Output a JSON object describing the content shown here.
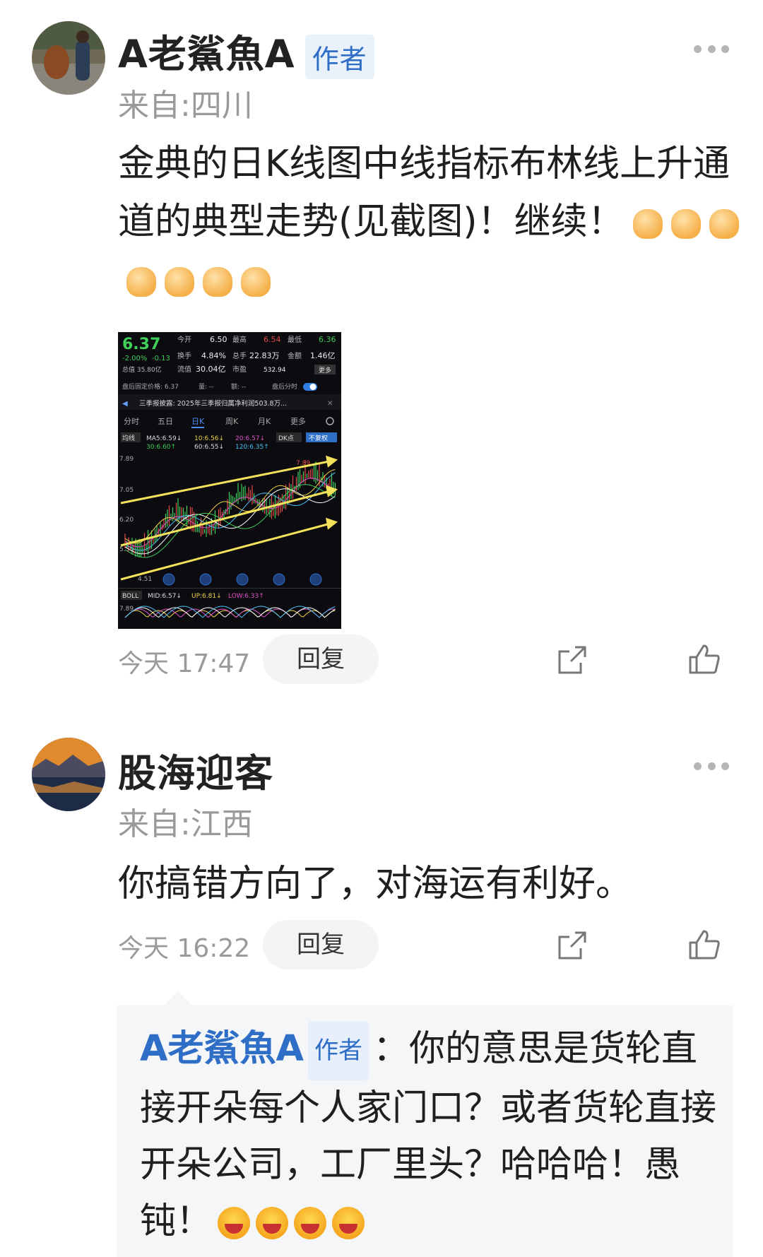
{
  "comments": [
    {
      "user": "A老鯊魚A",
      "tag": "作者",
      "location": "来自:四川",
      "text": "金典的日K线图中线指标布林线上升通道的典型走势(见截图)！继续！",
      "emoji_count": 7,
      "time": "今天 17:47",
      "reply_label": "回复",
      "attachment": {
        "price": "6.37",
        "open_label": "今开",
        "open": "6.50",
        "high_label": "最高",
        "high": "6.54",
        "low_label": "最低",
        "low": "6.36",
        "change": "-2.00%",
        "change_abs": "-0.13",
        "turnover_label": "换手",
        "turnover": "4.84%",
        "volume_label": "总手",
        "volume": "22.83万",
        "amount_label": "金额",
        "amount": "1.46亿",
        "mcap": "总值 35.80亿",
        "float_label": "流值",
        "float": "30.04亿",
        "pe_label": "市盈",
        "pe": "532.94",
        "more_label": "更多",
        "after_hours": "盘后固定价格: 6.37",
        "after_vol": "量: --",
        "after_amt": "额: --",
        "after_toggle": "盘后分时",
        "news": "三季报披露: 2025年三季报归属净利润503.8万...",
        "tabs": [
          "分时",
          "五日",
          "日K",
          "周K",
          "月K",
          "更多"
        ],
        "ma_label": "均线",
        "ma5": "MA5:6.59↓",
        "ma10": "10:6.56↓",
        "ma20": "20:6.57↓",
        "ma30": "30:6.60↑",
        "ma60": "60:6.55↓",
        "ma120": "120:6.35↑",
        "dk": "DK点",
        "restore": "不复权",
        "y_top": "7.89",
        "y2": "7.05",
        "y3": "6.20",
        "y4": "5.36",
        "y_bottom": "4.51",
        "peak": "7.89",
        "boll": "BOLL",
        "mid": "MID:6.57↓",
        "up": "UP:6.81↓",
        "lowb": "LOW:6.33↑",
        "boll_y": "7.89"
      }
    },
    {
      "user": "股海迎客",
      "location": "来自:江西",
      "text": "你搞错方向了，对海运有利好。",
      "time": "今天 16:22",
      "reply_label": "回复",
      "sub_reply": {
        "user": "A老鯊魚A",
        "tag": "作者",
        "text": "：你的意思是货轮直接开朵每个人家门口？或者货轮直接开朵公司，工厂里头？哈哈哈！愚钝！",
        "emoji_count": 4
      }
    }
  ]
}
